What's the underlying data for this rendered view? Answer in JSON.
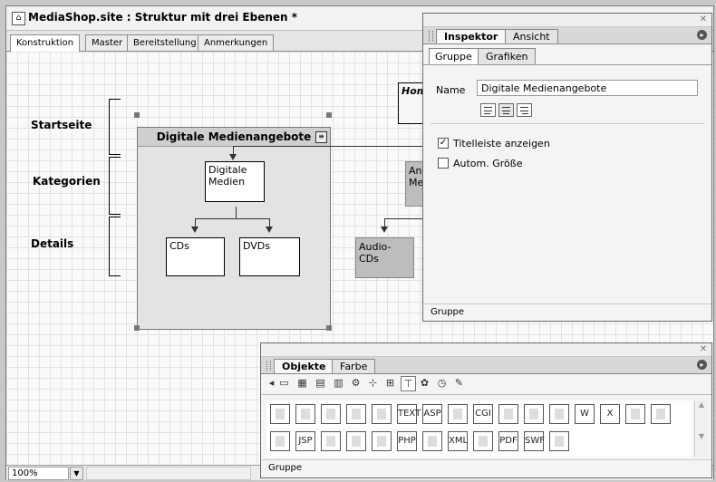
{
  "window": {
    "title": "MediaShop.site : Struktur mit drei Ebenen *",
    "tabs": [
      "Konstruktion",
      "Master",
      "Bereitstellung",
      "Anmerkungen"
    ]
  },
  "diagram": {
    "levels": [
      "Startseite",
      "Kategorien",
      "Details"
    ],
    "group_title": "Digitale Medienangebote",
    "pages": {
      "digitale_medien": "Digitale\nMedien",
      "cds": "CDs",
      "dvds": "DVDs",
      "audio_cds": "Audio-CDs",
      "analog_partial": "An\nMe",
      "home_partial": "Hom"
    }
  },
  "status": {
    "zoom": "100%"
  },
  "inspector": {
    "tabs": [
      "Inspektor",
      "Ansicht"
    ],
    "subtabs": [
      "Gruppe",
      "Grafiken"
    ],
    "name_label": "Name",
    "name_value": "Digitale Medienangebote",
    "checkbox_title": {
      "label": "Titelleiste anzeigen",
      "checked": true
    },
    "checkbox_auto": {
      "label": "Autom. Größe",
      "checked": false
    },
    "footer": "Gruppe"
  },
  "objects": {
    "tabs": [
      "Objekte",
      "Farbe"
    ],
    "footer": "Gruppe",
    "toolbar_icons": [
      "arrow-left-icon",
      "page-icon",
      "grid-icon",
      "layout-icon",
      "frame-icon",
      "gear-icon",
      "sitemap-icon",
      "structure-icon",
      "tree-icon",
      "palette-icon",
      "clock-icon",
      "pen-icon"
    ],
    "row1_icons": [
      "page-object-icon",
      "sitemap-object-icon",
      "text-page-icon",
      "document-icon",
      "form-icon",
      "text-object-icon",
      "asp-icon",
      "file-icon",
      "cgi-icon",
      "database-icon",
      "doc-icon",
      "htm-icon",
      "word-icon",
      "excel-icon",
      "page2-icon",
      "tv-icon"
    ],
    "row2_icons": [
      "link-icon",
      "jsp-icon",
      "copy-icon",
      "doc2-icon",
      "image-icon",
      "php-icon",
      "page3-icon",
      "xml-icon",
      "list-icon",
      "pdf-icon",
      "swf-icon",
      "book-icon"
    ],
    "row1_labels": [
      "",
      "",
      "",
      "",
      "",
      "TEXT",
      "ASP",
      "",
      "CGI",
      "",
      "",
      "",
      "W",
      "X",
      "",
      ""
    ],
    "row2_labels": [
      "",
      "JSP",
      "",
      "",
      "",
      "PHP",
      "",
      "XML",
      "",
      "PDF",
      "SWF",
      ""
    ]
  }
}
